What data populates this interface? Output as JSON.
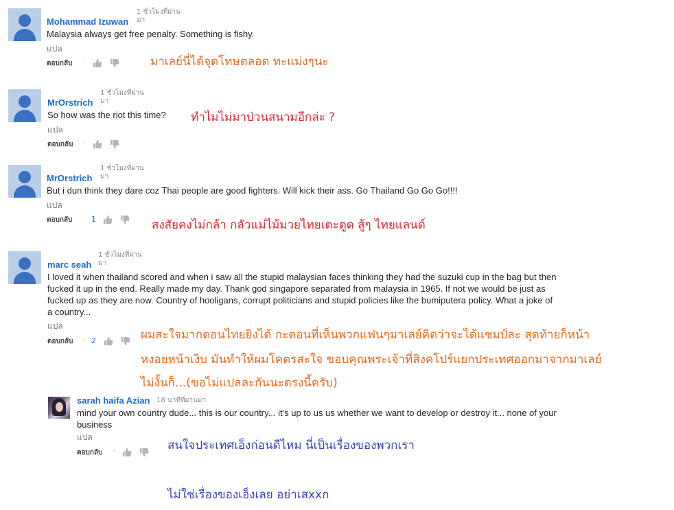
{
  "comments": [
    {
      "author": "Mohammad Izuwan",
      "time_l1": "1 ชั่วโมงที่ผ่าน",
      "time_l2": "มา",
      "text": [
        "Malaysia always get free penalty. Something is fishy."
      ],
      "translate": "แปล",
      "reply": "ตอบกลับ",
      "likes": ""
    },
    {
      "author": "MrOrstrich",
      "time_l1": "1 ชั่วโมงที่ผ่าน",
      "time_l2": "มา",
      "text": [
        "So how was the riot this time?"
      ],
      "translate": "แปล",
      "reply": "ตอบกลับ",
      "likes": ""
    },
    {
      "author": "MrOrstrich",
      "time_l1": "1 ชั่วโมงที่ผ่าน",
      "time_l2": "มา",
      "text": [
        "But i dun think they dare coz Thai people are good fighters. Will kick their ass. Go Thailand Go Go Go!!!!"
      ],
      "translate": "แปล",
      "reply": "ตอบกลับ",
      "likes": "1"
    },
    {
      "author": "marc seah",
      "time_l1": "1 ชั่วโมงที่ผ่าน",
      "time_l2": "มา",
      "text": [
        "I loved it when thailand scored and when i saw all the stupid malaysian faces thinking they had the suzuki cup in the bag but then",
        "fucked it up in the end. Really made my day. Thank god singapore separated from malaysia in 1965. If not we would be just as",
        "fucked up as they are now. Country of hooligans, corrupt politicians and stupid policies like the bumiputera policy. What a joke of",
        "a country..."
      ],
      "translate": "แปล",
      "reply": "ตอบกลับ",
      "likes": "2"
    }
  ],
  "reply_comment": {
    "author": "sarah haifa Azian",
    "time": "18 นาทีที่ผ่านมา",
    "text": [
      "mind your own country dude... this is our country... it's up to us us whether we want to develop or destroy it... none of your",
      "business"
    ],
    "translate": "แปล",
    "reply": "ตอบกลับ"
  },
  "overlays": {
    "o1": "มาเลย์นี่ได้จุดโทษตลอด   ทะแม่งๆนะ",
    "o2": "ทำไมไม่มาป่วนสนามอีกล่ะ   ?",
    "o3": "สงสัยคงไม่กล้า   กลัวแม่ไม้มวยไทยเตะตูด   สู้ๆ   ไทยแลนด์",
    "o4a": "ผมสะใจมากตอนไทยยิงได้   กะตอนที่เห็นพวกแฟนๆมาเลย์คิดว่าจะได้แชมป์ละ   สุดท้ายก็หน้า",
    "o4b": "หงอยหน้าเงิบ   มันทำให้ผมโคตรสะใจ   ขอบคุณพระเจ้าที่สิงคโปร์แยกประเทศออกมาจากมาเลย์",
    "o4c": "ไม่งั้นก็...(ขอไม่แปลละกันนะตรงนี้ครับ)",
    "o5a": "สนใจประเทศเอ็งก่อนดีไหม   นี่เป็นเรื่องของพวกเรา",
    "o5b": "ไม่ใช่เรื่องของเอ็งเลย   อย่าเสxxก"
  },
  "colors": {
    "author": "#1b6ac9",
    "overlay_orange": "#d86a2b",
    "overlay_red": "#d8262f",
    "overlay_blue": "#3a44b8"
  },
  "icons": [
    "thumbs-up-icon",
    "thumbs-down-icon",
    "default-avatar-icon"
  ]
}
